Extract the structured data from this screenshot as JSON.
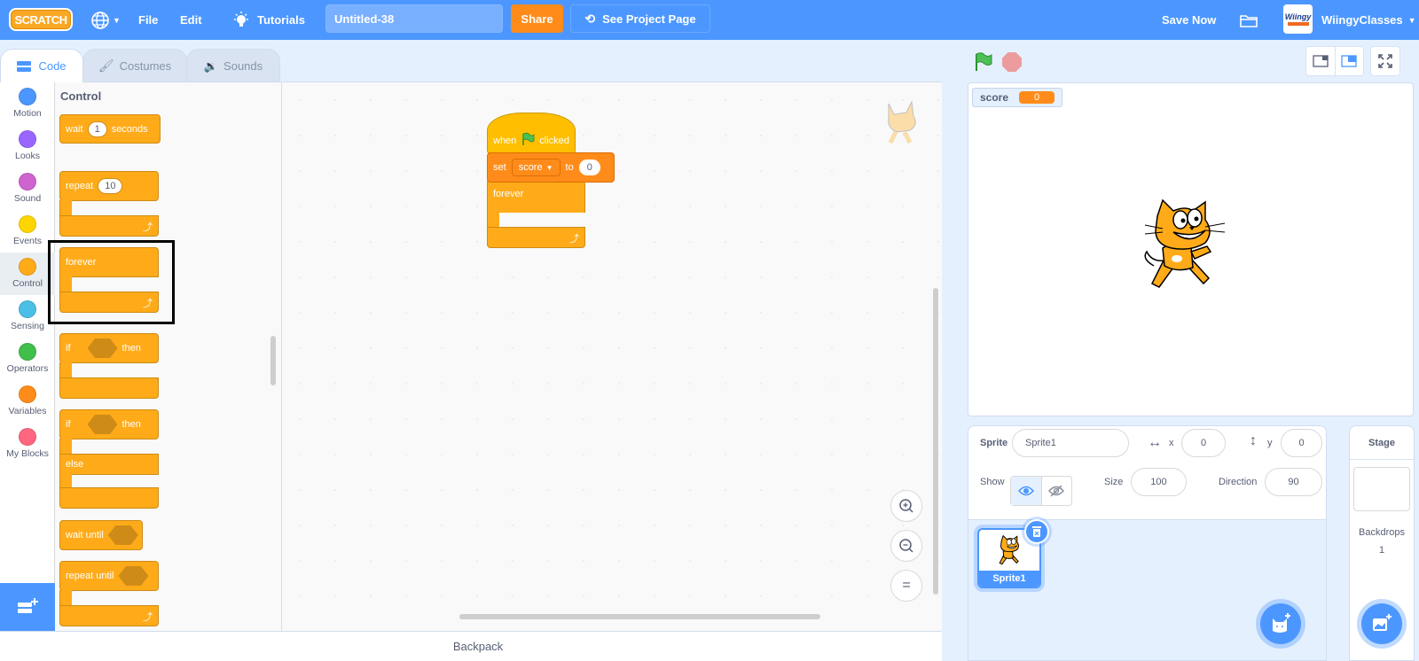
{
  "menubar": {
    "logo": "SCRATCH",
    "file": "File",
    "edit": "Edit",
    "tutorials": "Tutorials",
    "project_title": "Untitled-38",
    "share": "Share",
    "see_project_page": "See Project Page",
    "save_now": "Save Now",
    "avatar_text": "Wiingy",
    "username": "WiingyClasses"
  },
  "tabs": [
    {
      "label": "Code",
      "active": true
    },
    {
      "label": "Costumes",
      "active": false
    },
    {
      "label": "Sounds",
      "active": false
    }
  ],
  "categories": [
    {
      "label": "Motion",
      "color": "#4c97ff"
    },
    {
      "label": "Looks",
      "color": "#9966ff"
    },
    {
      "label": "Sound",
      "color": "#cf63cf"
    },
    {
      "label": "Events",
      "color": "#ffd500"
    },
    {
      "label": "Control",
      "color": "#ffab19",
      "active": true
    },
    {
      "label": "Sensing",
      "color": "#4cbfe6"
    },
    {
      "label": "Operators",
      "color": "#40bf4a"
    },
    {
      "label": "Variables",
      "color": "#ff8c1a"
    },
    {
      "label": "My Blocks",
      "color": "#ff6680"
    }
  ],
  "palette": {
    "title": "Control",
    "blocks": {
      "wait": {
        "pre": "wait",
        "value": "1",
        "post": "seconds"
      },
      "repeat": {
        "pre": "repeat",
        "value": "10"
      },
      "forever": {
        "label": "forever"
      },
      "if_then": {
        "pre": "if",
        "post": "then"
      },
      "if_else": {
        "pre": "if",
        "post": "then",
        "else": "else"
      },
      "wait_until": {
        "label": "wait until"
      },
      "repeat_until": {
        "label": "repeat until"
      }
    }
  },
  "script": {
    "hat": {
      "pre": "when",
      "post": "clicked"
    },
    "set": {
      "pre": "set",
      "variable": "score",
      "mid": "to",
      "value": "0"
    },
    "forever": "forever"
  },
  "zoom_controls": {
    "zoom_in": "+",
    "zoom_out": "−",
    "reset": "="
  },
  "backpack": "Backpack",
  "stage": {
    "monitor": {
      "name": "score",
      "value": "0"
    }
  },
  "sprite_info": {
    "sprite_label": "Sprite",
    "sprite_name": "Sprite1",
    "x_label": "x",
    "x_value": "0",
    "y_label": "y",
    "y_value": "0",
    "show_label": "Show",
    "size_label": "Size",
    "size_value": "100",
    "direction_label": "Direction",
    "direction_value": "90"
  },
  "sprites": [
    {
      "name": "Sprite1",
      "selected": true
    }
  ],
  "stage_pane": {
    "title": "Stage",
    "backdrops_label": "Backdrops",
    "backdrops_count": "1"
  },
  "colors": {
    "menubar": "#4c97ff",
    "control": "#ffab19",
    "events": "#ffbf00",
    "variables": "#ff8c1a",
    "share": "#ff8c1a"
  }
}
